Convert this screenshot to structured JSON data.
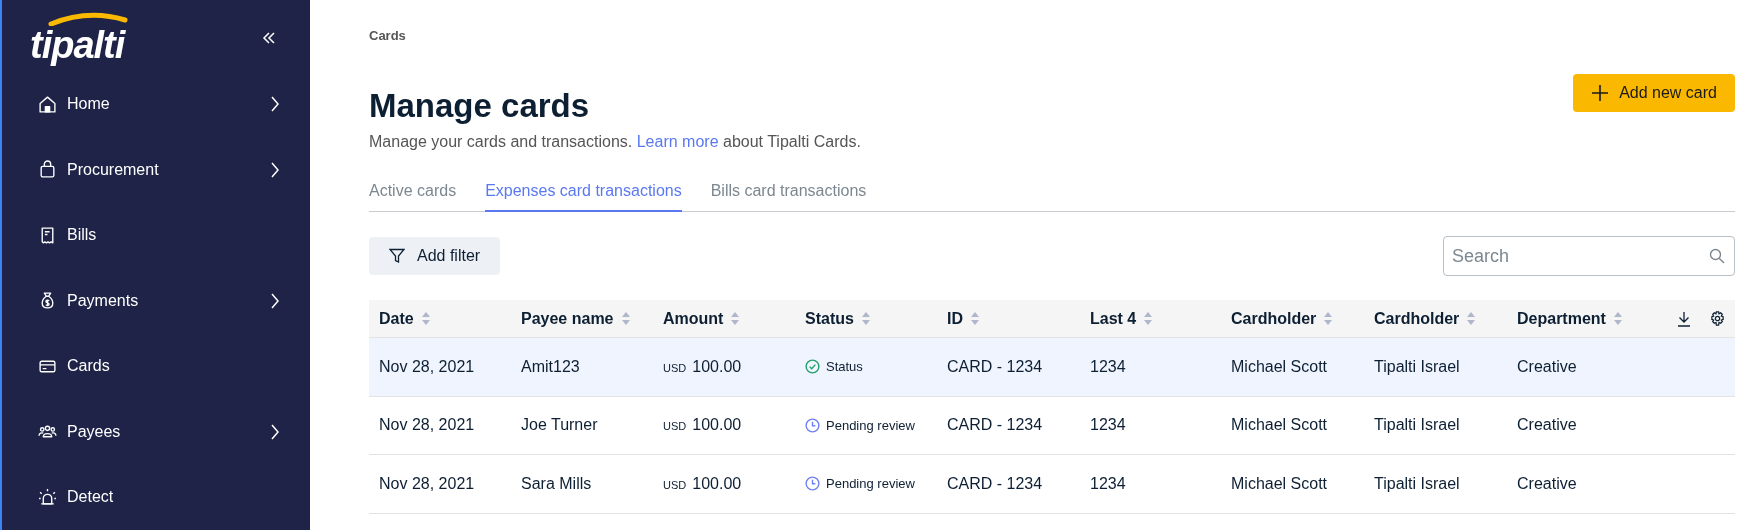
{
  "sidebar": {
    "logo": "tipalti",
    "items": [
      {
        "label": "Home",
        "expandable": true
      },
      {
        "label": "Procurement",
        "expandable": true
      },
      {
        "label": "Bills",
        "expandable": false
      },
      {
        "label": "Payments",
        "expandable": true
      },
      {
        "label": "Cards",
        "expandable": false
      },
      {
        "label": "Payees",
        "expandable": true
      },
      {
        "label": "Detect",
        "expandable": false
      }
    ]
  },
  "breadcrumb": "Cards",
  "title": "Manage cards",
  "subtitle_parts": [
    "Manage your cards and transactions.",
    "Learn more",
    "about Tipalti Cards."
  ],
  "add_button": "Add new card",
  "tabs": [
    {
      "label": "Active cards",
      "selected": false
    },
    {
      "label": "Expenses card transactions",
      "selected": true
    },
    {
      "label": "Bills card transactions",
      "selected": false
    }
  ],
  "filter_button": "Add filter",
  "search": {
    "placeholder": "Search"
  },
  "table": {
    "columns": [
      "Date",
      "Payee name",
      "Amount",
      "Status",
      "ID",
      "Last 4",
      "Cardholder",
      "Cardholder",
      "Department"
    ],
    "rows": [
      {
        "selected": true,
        "date": "Nov 28, 2021",
        "payee": "Amit123",
        "currency": "USD",
        "amount": "100.00",
        "status": {
          "kind": "approved",
          "label": "Status"
        },
        "id": "CARD - 1234",
        "last4": "1234",
        "cardholder": "Michael Scott",
        "entity": "Tipalti Israel",
        "department": "Creative"
      },
      {
        "selected": false,
        "date": "Nov 28, 2021",
        "payee": "Joe Turner",
        "currency": "USD",
        "amount": "100.00",
        "status": {
          "kind": "pending",
          "label": "Pending review"
        },
        "id": "CARD - 1234",
        "last4": "1234",
        "cardholder": "Michael Scott",
        "entity": "Tipalti Israel",
        "department": "Creative"
      },
      {
        "selected": false,
        "date": "Nov 28, 2021",
        "payee": "Sara Mills",
        "currency": "USD",
        "amount": "100.00",
        "status": {
          "kind": "pending",
          "label": "Pending review"
        },
        "id": "CARD - 1234",
        "last4": "1234",
        "cardholder": "Michael Scott",
        "entity": "Tipalti Israel",
        "department": "Creative"
      }
    ]
  }
}
